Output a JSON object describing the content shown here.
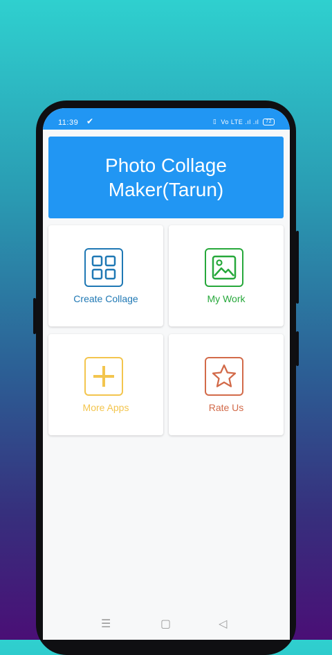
{
  "status_bar": {
    "time": "11:39",
    "right_info": "Vo LTE  .ıl  .ıl",
    "battery": "72"
  },
  "banner": {
    "title": "Photo Collage Maker(Tarun)"
  },
  "menu": [
    {
      "label": "Create Collage",
      "icon": "grid-icon",
      "color": "#1f78b4"
    },
    {
      "label": "My Work",
      "icon": "image-icon",
      "color": "#27a83b"
    },
    {
      "label": "More Apps",
      "icon": "plus-icon",
      "color": "#f3c54e"
    },
    {
      "label": "Rate Us",
      "icon": "star-icon",
      "color": "#d26a49"
    }
  ],
  "nav": {
    "menu": "☰",
    "home": "▢",
    "back": "◁"
  }
}
